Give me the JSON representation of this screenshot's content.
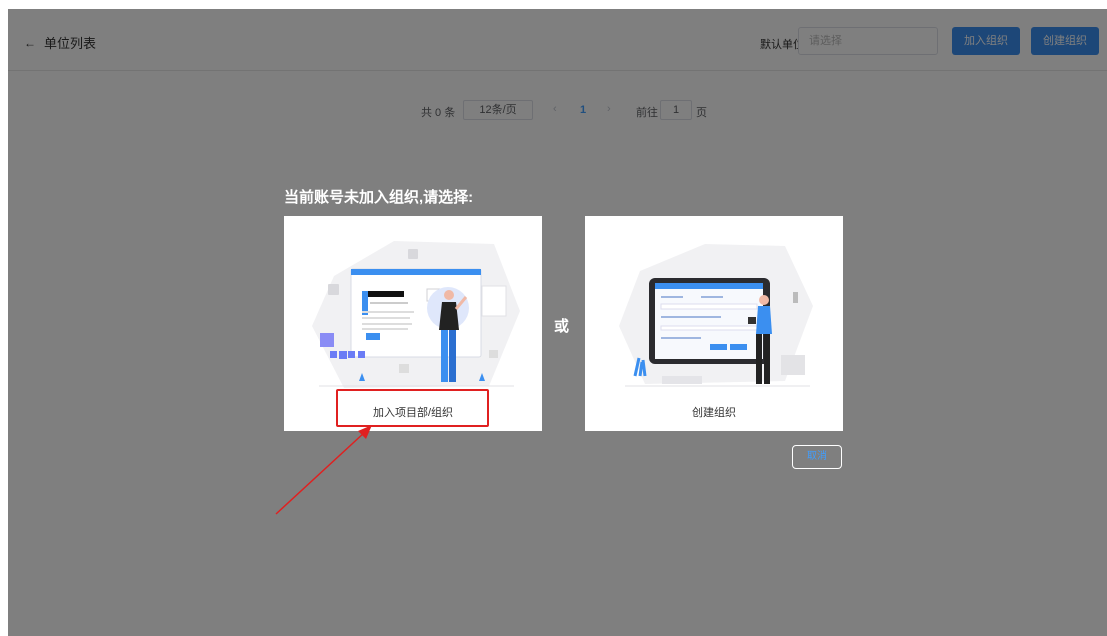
{
  "header": {
    "back_label": "单位列表",
    "default_unit_label": "默认单位",
    "unit_select_placeholder": "请选择",
    "join_button": "加入组织",
    "create_button": "创建组织"
  },
  "pagination": {
    "total_text": "共 0 条",
    "page_size": "12条/页",
    "current_page": "1",
    "goto_label": "前往",
    "goto_value": "1",
    "page_suffix": "页"
  },
  "dialog": {
    "prompt": "当前账号未加入组织,请选择:",
    "option_join_label": "加入项目部/组织",
    "or_text": "或",
    "option_create_label": "创建组织",
    "cancel_label": "取消"
  },
  "colors": {
    "primary": "#3b8ff0",
    "highlight": "#e02020",
    "overlay": "rgba(0,0,0,0.5)"
  }
}
